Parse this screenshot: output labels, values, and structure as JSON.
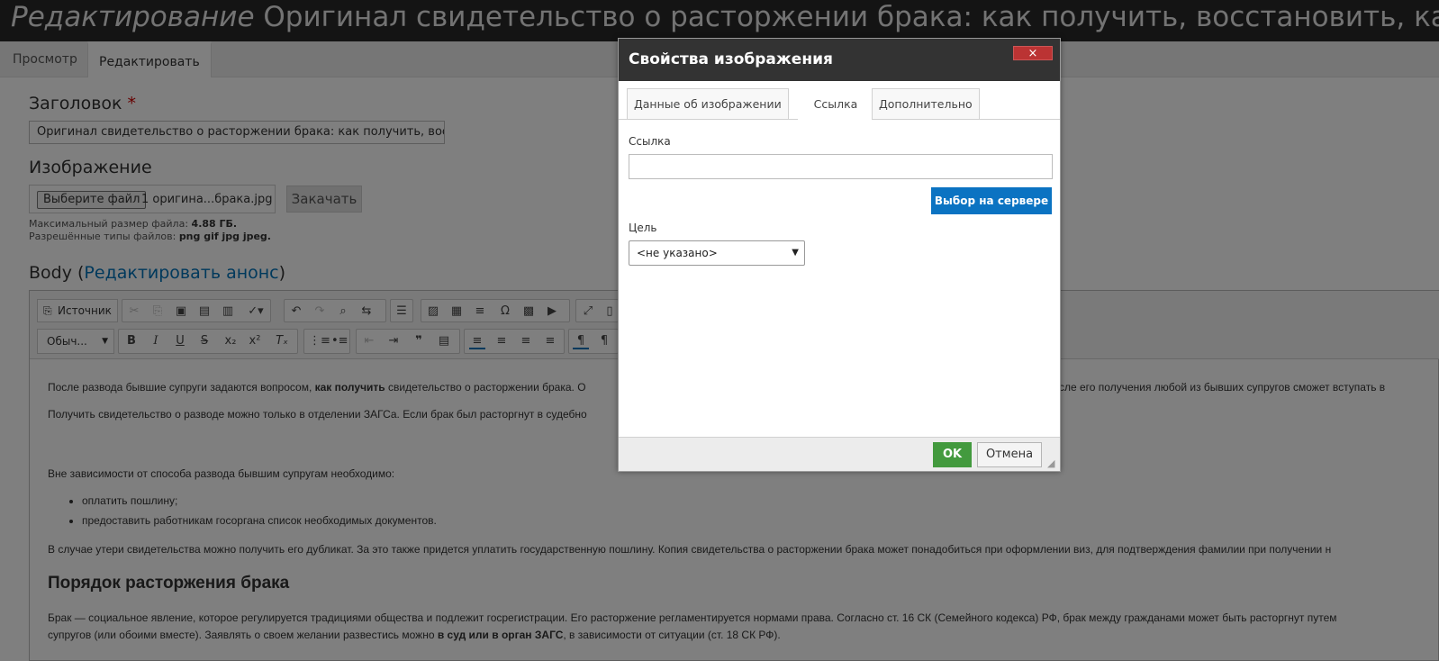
{
  "page": {
    "title_prefix": "Редактирование",
    "title_rest": " Оригинал свидетельство о расторжении брака: как получить, восстановить, как выглядит",
    "tab_view": "Просмотр",
    "tab_edit": "Редактировать"
  },
  "form": {
    "title_label": "Заголовок",
    "required_mark": "*",
    "title_value": "Оригинал свидетельство о расторжении брака: как получить, восстановить, как выглядит",
    "image_label": "Изображение",
    "file_button": "Выберите файл",
    "file_name": "1 оригина...брака.jpg",
    "upload_button": "Закачать",
    "max_size_label": "Максимальный размер файла: ",
    "max_size_value": "4.88 ГБ.",
    "types_label": "Разрешённые типы файлов: ",
    "types_value": "png gif jpg jpeg.",
    "body_label": "Body (",
    "body_link": "Редактировать анонс",
    "body_close": ")"
  },
  "editor": {
    "source_button": "Источник",
    "format_select": "Обыч...",
    "p1_a": "После развода бывшие супруги задаются вопросом, ",
    "p1_b": "как получить",
    "p1_c": " свидетельство о расторжении брака. О",
    "p1_tail": "сле его получения любой из бывших супругов сможет вступать в",
    "p2": "Получить свидетельство о разводе можно только в отделении ЗАГСа. Если брак был расторгнут в судебно",
    "p3": "Вне зависимости от способа развода бывшим супругам необходимо:",
    "li1": "оплатить пошлину;",
    "li2": "предоставить работникам госоргана список необходимых документов.",
    "p4": "В случае утери свидетельства можно получить его дубликат. За это также придется уплатить государственную пошлину. Копия свидетельства о расторжении брака может понадобиться при оформлении виз, для подтверждения фамилии при получении н",
    "h2": "Порядок расторжения брака",
    "p5": "Брак — социальное явление, которое регулируется традициями общества и подлежит госрегистрации. Его расторжение регламентируется нормами права. Согласно ст. 16 СК (Семейного кодекса) РФ, брак между гражданами может быть расторгнут путем",
    "p6_a": "супругов (или обоими вместе). Заявлять о своем желании развестись можно ",
    "p6_b": "в суд или в орган ЗАГС",
    "p6_c": ", в зависимости от ситуации (ст. 18 СК РФ)."
  },
  "dialog": {
    "title": "Свойства изображения",
    "close": "×",
    "tabs": [
      "Данные об изображении",
      "Ссылка",
      "Дополнительно"
    ],
    "link_label": "Ссылка",
    "link_value": "",
    "browse_button": "Выбор на сервере",
    "target_label": "Цель",
    "target_value": "<не указано>",
    "ok": "OK",
    "cancel": "Отмена"
  }
}
